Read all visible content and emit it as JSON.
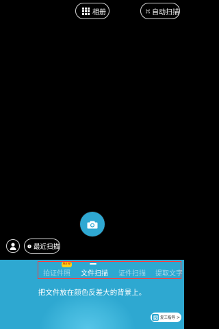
{
  "toolbar": {
    "album_label": "相册",
    "album_icon": "grid-icon",
    "autoscan_label": "自动扫描",
    "autoscan_icon": "scan-frame-icon"
  },
  "camera": {
    "shutter_icon": "camera-icon"
  },
  "bottom_left": {
    "user_icon": "user-icon",
    "recent_label": "最近扫描",
    "recent_icon": "clock-icon"
  },
  "modes": {
    "new_badge": "NEW",
    "tabs": [
      {
        "label": "拍证件照",
        "active": false
      },
      {
        "label": "文件扫描",
        "active": true
      },
      {
        "label": "证件扫描",
        "active": false
      },
      {
        "label": "提取文字",
        "active": false
      }
    ]
  },
  "hint": "把文件放在颜色反差大的背景上。",
  "tutorial": {
    "label": "复工指导",
    "arrow": ">"
  },
  "colors": {
    "panel": "#2ea8d1",
    "accent": "#2fa8d2",
    "badge": "#ffd21a",
    "highlight_border": "#ff3b3b"
  }
}
